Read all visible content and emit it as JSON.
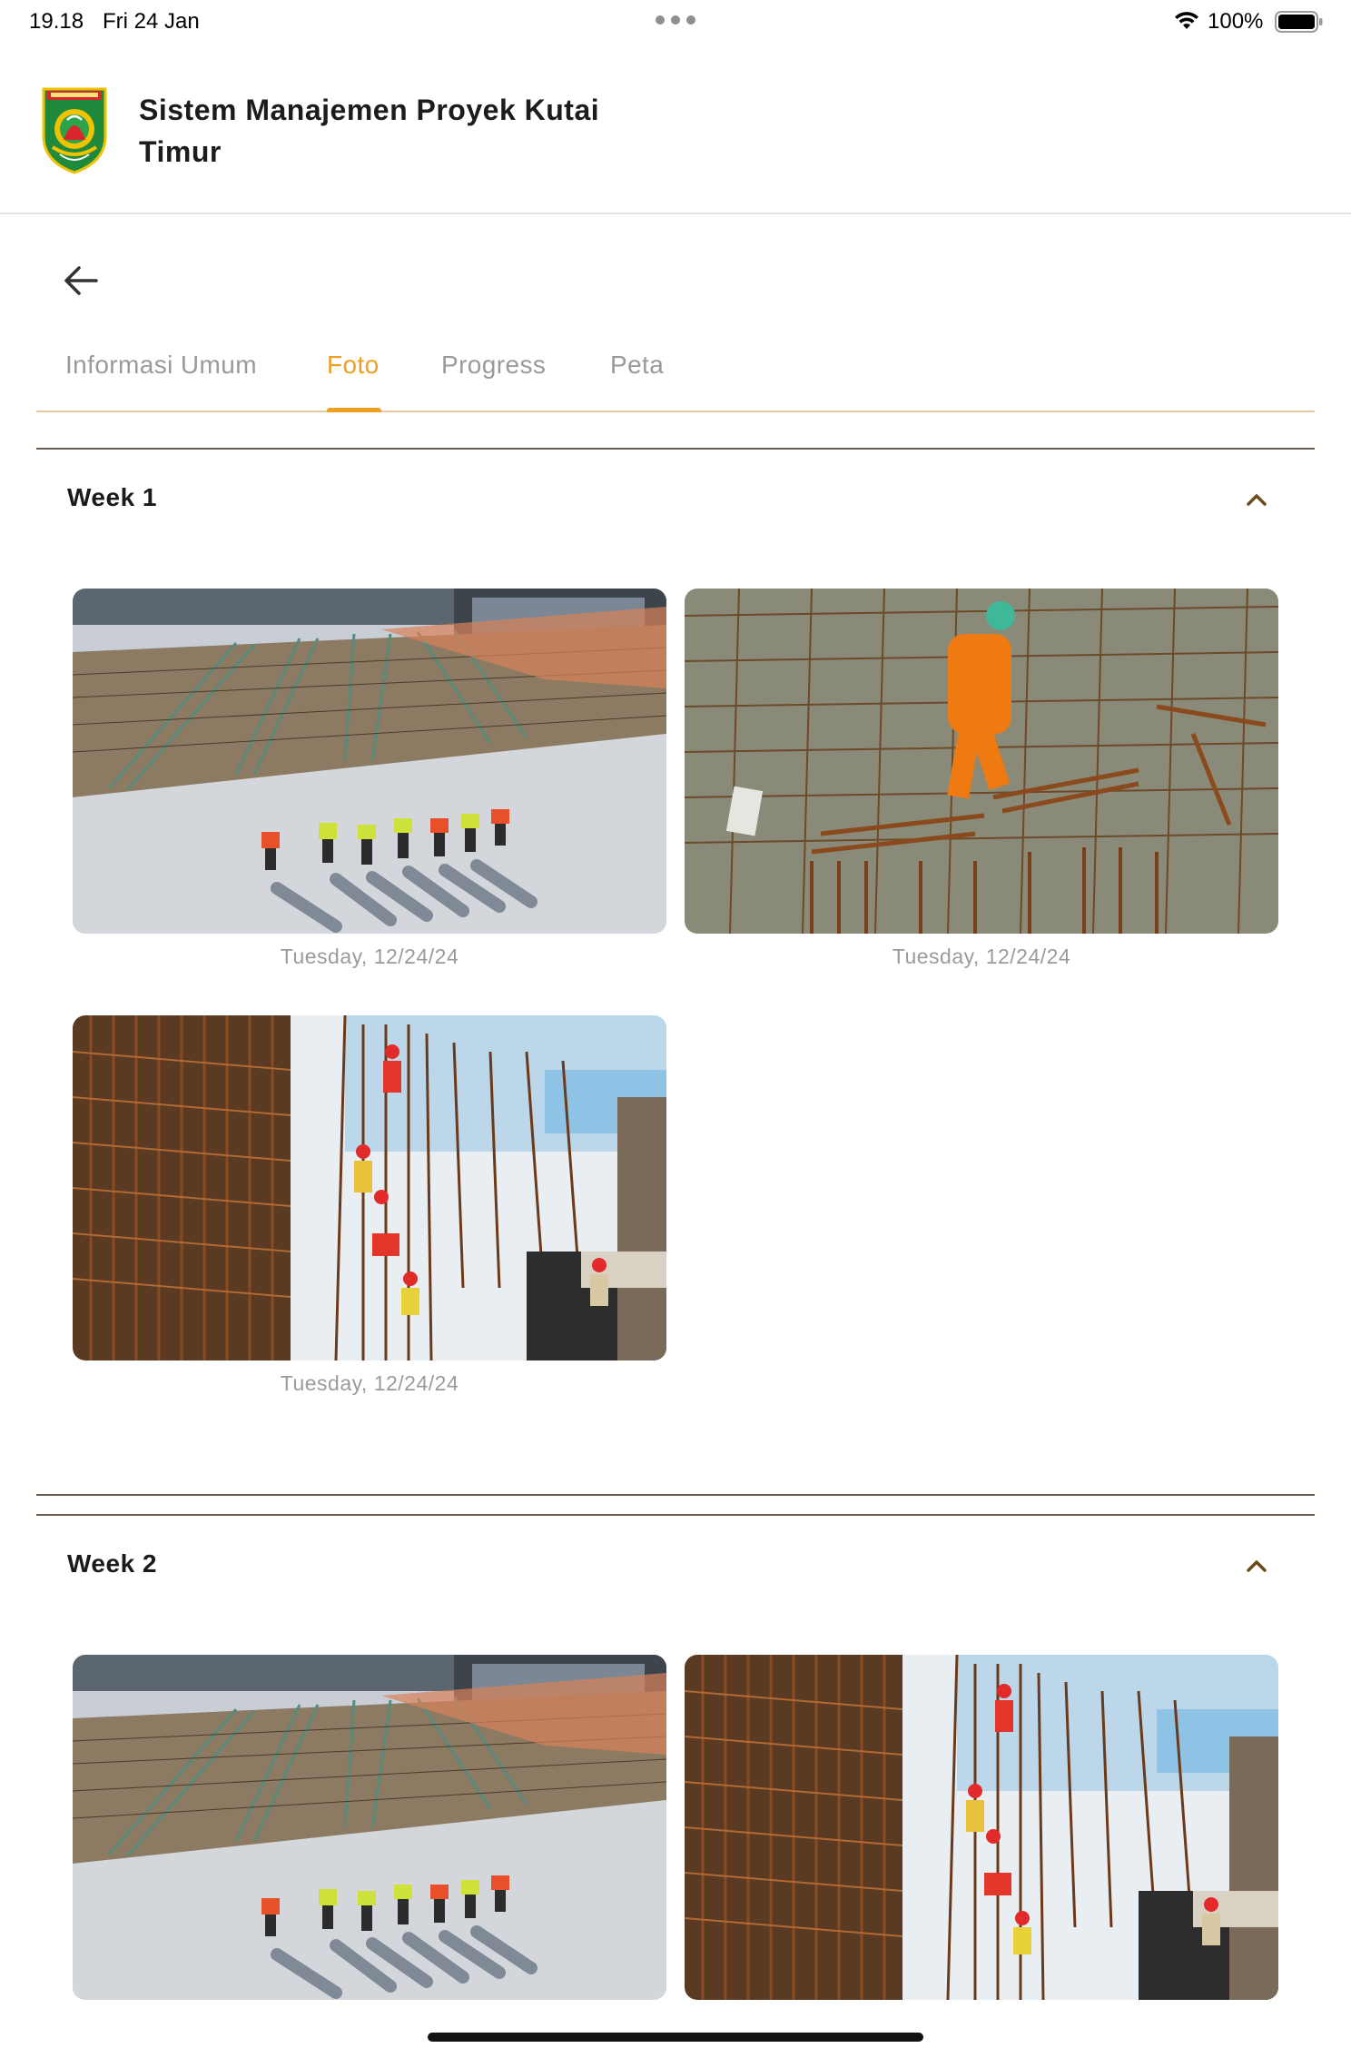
{
  "status_bar": {
    "time": "19.18",
    "date": "Fri 24 Jan",
    "battery_percent": "100%",
    "battery_level": 1.0,
    "wifi_icon": "wifi-icon",
    "battery_icon": "battery-icon"
  },
  "app": {
    "title": "Sistem Manajemen Proyek Kutai Timur",
    "logo_icon": "kutai-timur-emblem-logo"
  },
  "nav": {
    "back_icon": "arrow-left-icon"
  },
  "tabs": [
    {
      "label": "Informasi Umum",
      "active": false
    },
    {
      "label": "Foto",
      "active": true
    },
    {
      "label": "Progress",
      "active": false
    },
    {
      "label": "Peta",
      "active": false
    }
  ],
  "colors": {
    "accent": "#f0a020",
    "tab_inactive": "#9a9a9a",
    "divider": "#6b5a4e",
    "chevron": "#6b4a1e"
  },
  "sections": [
    {
      "title": "Week 1",
      "expanded": true,
      "chevron_icon": "chevron-up-icon",
      "photos": [
        {
          "caption": "Tuesday, 12/24/24",
          "scene": "construction-site-overhead"
        },
        {
          "caption": "Tuesday, 12/24/24",
          "scene": "worker-on-rebar"
        },
        {
          "caption": "Tuesday, 12/24/24",
          "scene": "rebar-column-workers"
        }
      ]
    },
    {
      "title": "Week 2",
      "expanded": true,
      "chevron_icon": "chevron-up-icon",
      "photos": [
        {
          "caption": "",
          "scene": "construction-site-overhead"
        },
        {
          "caption": "",
          "scene": "rebar-column-workers"
        }
      ]
    }
  ]
}
